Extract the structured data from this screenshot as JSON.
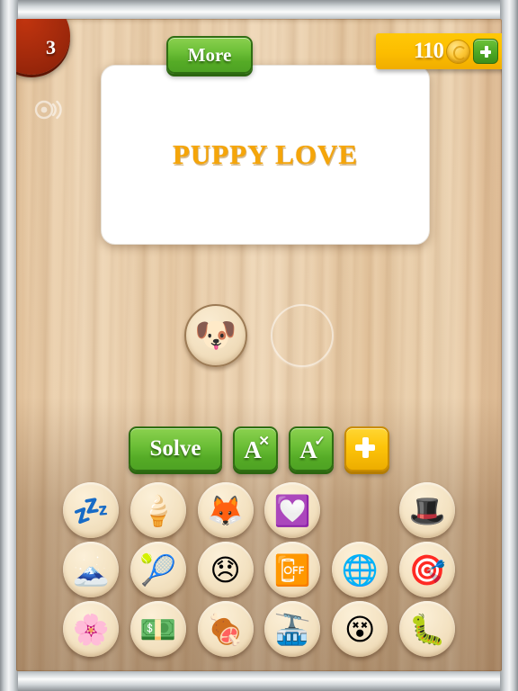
{
  "app": {
    "level_number": "3",
    "more_label": "More",
    "coins": "110",
    "coin_icon": "coin-icon",
    "add_coins_icon": "plus-icon",
    "sound_icon": "sound-on-icon"
  },
  "puzzle": {
    "card_text": "PUPPY LOVE",
    "slots": [
      {
        "filled": true,
        "emoji": "🐶",
        "name": "dog-face"
      },
      {
        "filled": false,
        "emoji": "",
        "name": "empty-slot"
      }
    ]
  },
  "actions": {
    "solve_label": "Solve",
    "remove_letters_label": "A",
    "remove_letters_sup": "✕",
    "reveal_letter_label": "A",
    "reveal_letter_sup": "✓",
    "add_label": "+"
  },
  "tray": {
    "rows": [
      [
        {
          "emoji": "💤",
          "name": "zzz-sleeping"
        },
        {
          "emoji": "🍦",
          "name": "soft-ice-cream"
        },
        {
          "emoji": "🦊",
          "name": "fox-face"
        },
        {
          "emoji": "💟",
          "name": "heart-decoration"
        },
        {
          "emoji": "",
          "name": "used-empty-tile"
        },
        {
          "emoji": "🎩",
          "name": "top-hat"
        }
      ],
      [
        {
          "emoji": "🗻",
          "name": "mount-fuji"
        },
        {
          "emoji": "🎾",
          "name": "tennis-racket"
        },
        {
          "emoji": "😞",
          "name": "disappointed-face"
        },
        {
          "emoji": "📴",
          "name": "mobile-phone-off"
        },
        {
          "emoji": "🌐",
          "name": "globe-with-meridians"
        },
        {
          "emoji": "🎯",
          "name": "direct-hit-target"
        }
      ],
      [
        {
          "emoji": "🌸",
          "name": "cherry-blossom"
        },
        {
          "emoji": "💵",
          "name": "dollar-banknote"
        },
        {
          "emoji": "🍖",
          "name": "meat-on-bone"
        },
        {
          "emoji": "🚠",
          "name": "aerial-tramway"
        },
        {
          "emoji": "😵",
          "name": "dizzy-face"
        },
        {
          "emoji": "🐛",
          "name": "caterpillar-bug"
        }
      ]
    ]
  },
  "colors": {
    "accent_green": "#55ab26",
    "accent_yellow": "#fdc40a",
    "badge_red": "#a32a0c",
    "card_text": "#f5a509",
    "wood_light": "#e6c9a4",
    "wood_dark": "#ab8566"
  }
}
